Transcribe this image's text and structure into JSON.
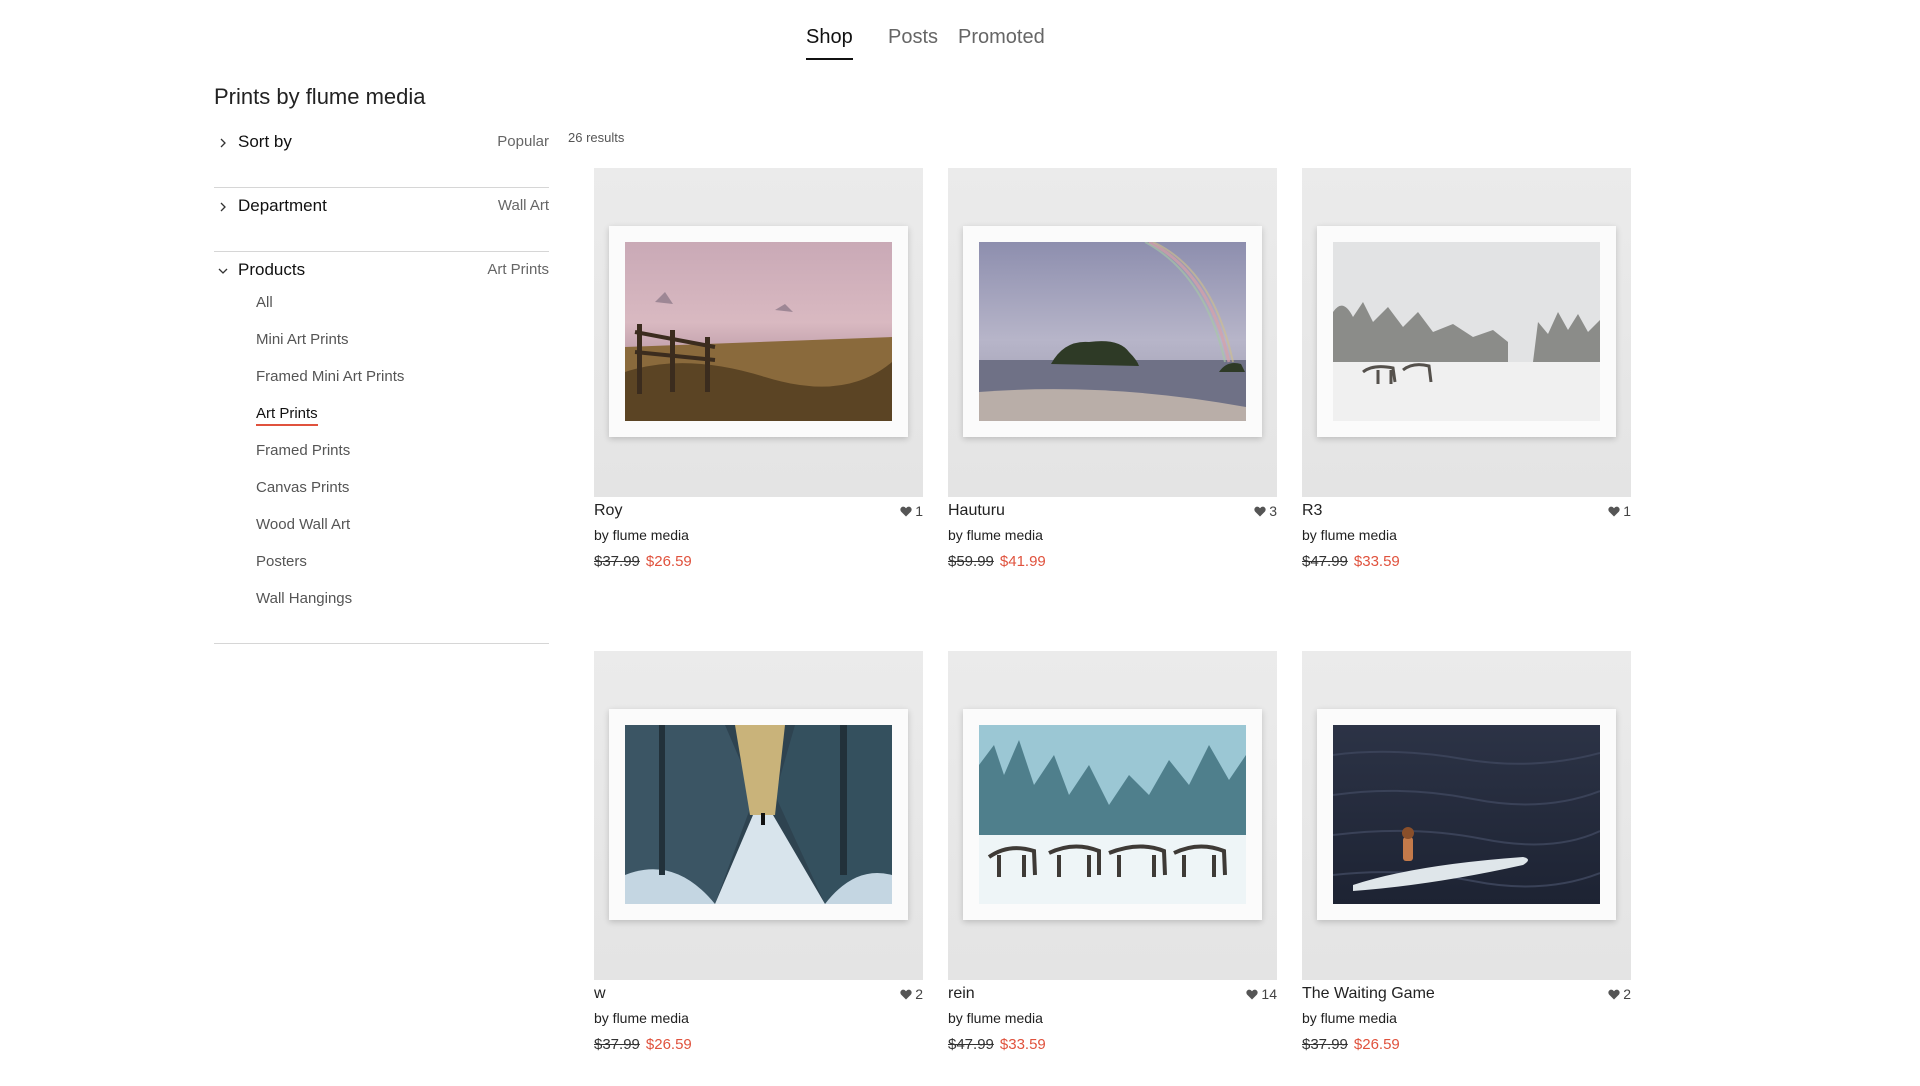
{
  "tabs": [
    {
      "label": "Shop",
      "active": true
    },
    {
      "label": "Posts",
      "active": false
    },
    {
      "label": "Promoted",
      "active": false
    }
  ],
  "sidebar": {
    "title": "Prints by flume media",
    "filters": [
      {
        "label": "Sort by",
        "value": "Popular",
        "expanded": false
      },
      {
        "label": "Department",
        "value": "Wall Art",
        "expanded": false
      },
      {
        "label": "Products",
        "value": "Art Prints",
        "expanded": true,
        "options": [
          "All",
          "Mini Art Prints",
          "Framed Mini Art Prints",
          "Art Prints",
          "Framed Prints",
          "Canvas Prints",
          "Wood Wall Art",
          "Posters",
          "Wall Hangings"
        ],
        "selected": "Art Prints"
      }
    ]
  },
  "results_count": "26 results",
  "products": [
    {
      "title": "Roy",
      "artist": "by flume media",
      "likes": "1",
      "price_old": "$37.99",
      "price_new": "$26.59",
      "image": "coastal-sunset-fence"
    },
    {
      "title": "Hauturu",
      "artist": "by flume media",
      "likes": "3",
      "price_old": "$59.99",
      "price_new": "$41.99",
      "image": "island-rainbow"
    },
    {
      "title": "R3",
      "artist": "by flume media",
      "likes": "1",
      "price_old": "$47.99",
      "price_new": "$33.59",
      "image": "snowy-reindeer-field"
    },
    {
      "title": "w",
      "artist": "by flume media",
      "likes": "2",
      "price_old": "$37.99",
      "price_new": "$26.59",
      "image": "snowy-forest-path"
    },
    {
      "title": "rein",
      "artist": "by flume media",
      "likes": "14",
      "price_old": "$47.99",
      "price_new": "$33.59",
      "image": "reindeer-herd-snow"
    },
    {
      "title": "The Waiting Game",
      "artist": "by flume media",
      "likes": "2",
      "price_old": "$37.99",
      "price_new": "$26.59",
      "image": "surfer-on-water"
    }
  ],
  "colors": {
    "accent": "#e0523d",
    "text": "#222222",
    "muted": "#666666",
    "divider": "#d6d6d6"
  },
  "icons": {
    "chevron_right": "chevron-right-icon",
    "chevron_down": "chevron-down-icon",
    "heart": "heart-icon"
  }
}
